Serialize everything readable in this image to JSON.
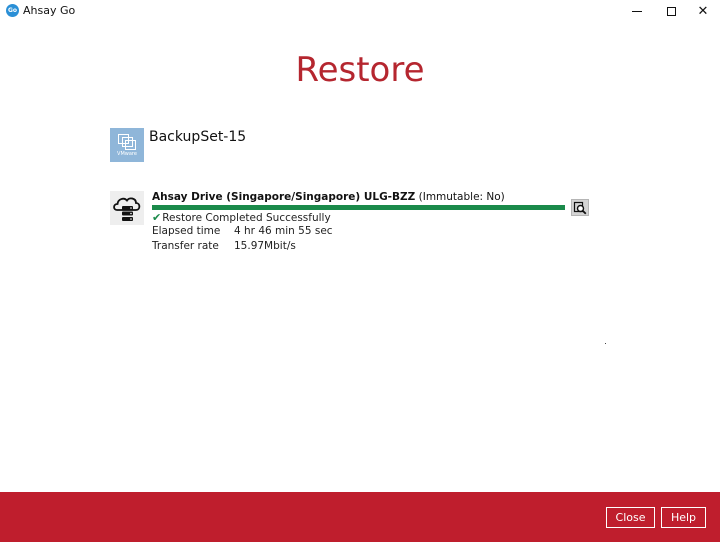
{
  "window": {
    "app_title": "Ahsay Go",
    "logo_text": "Go"
  },
  "page": {
    "title": "Restore"
  },
  "backupset": {
    "name": "BackupSet-15",
    "icon": "vmware-icon",
    "icon_label": "VMware"
  },
  "destination": {
    "name": "Ahsay Drive (Singapore/Singapore) ULG-BZZ",
    "immutable": "(Immutable: No)",
    "icon": "cloud-server-icon",
    "progress": 1.0,
    "status": "Restore Completed Successfully",
    "elapsed_label": "Elapsed time",
    "elapsed_value": "4 hr 46 min 55 sec",
    "rate_label": "Transfer rate",
    "rate_value": "15.97Mbit/s"
  },
  "footer": {
    "close_label": "Close",
    "help_label": "Help"
  },
  "colors": {
    "brand_red": "#bf1e2d",
    "title_red": "#b5262f",
    "progress_green": "#1a8a4a"
  }
}
